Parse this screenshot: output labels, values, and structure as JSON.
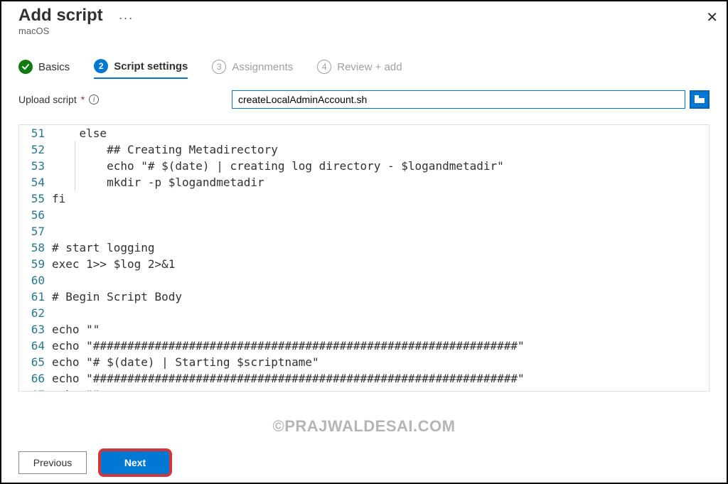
{
  "header": {
    "title": "Add script",
    "subtitle": "macOS"
  },
  "steps": [
    {
      "num": "✓",
      "label": "Basics"
    },
    {
      "num": "2",
      "label": "Script settings"
    },
    {
      "num": "3",
      "label": "Assignments"
    },
    {
      "num": "4",
      "label": "Review + add"
    }
  ],
  "upload": {
    "label": "Upload script",
    "value": "createLocalAdminAccount.sh"
  },
  "code": {
    "first_line": 51,
    "lines": [
      "    else",
      "        ## Creating Metadirectory",
      "        echo \"# $(date) | creating log directory - $logandmetadir\"",
      "        mkdir -p $logandmetadir",
      "fi",
      "",
      "",
      "# start logging",
      "exec 1>> $log 2>&1",
      "",
      "# Begin Script Body",
      "",
      "echo \"\"",
      "echo \"##############################################################\"",
      "echo \"# $(date) | Starting $scriptname\"",
      "echo \"##############################################################\"",
      "echo \"\""
    ]
  },
  "footer": {
    "previous": "Previous",
    "next": "Next"
  },
  "watermark": "©PRAJWALDESAI.COM"
}
